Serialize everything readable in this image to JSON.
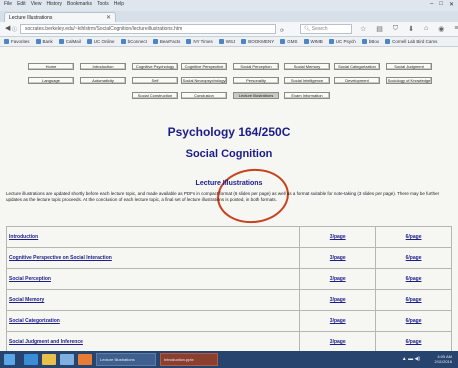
{
  "browser": {
    "menu": [
      "File",
      "Edit",
      "View",
      "History",
      "Bookmarks",
      "Tools",
      "Help"
    ],
    "window_controls": [
      "–",
      "□",
      "✕"
    ],
    "tab_title": "Lecture Illustrations",
    "url": "socrates.berkeley.edu/~kihlstrm/SocialCognition/lectureillustrations.htm",
    "search_placeholder": "Search",
    "bookmarks": [
      "Favorites",
      "Bank",
      "CalMail",
      "UC Online",
      "bConnect",
      "BearFacts",
      "NY Times",
      "WSJ",
      "BOOKMENY",
      "GMS",
      "WIMB",
      "UC Psych",
      "bBox",
      "Cornell Lab Bird Cams"
    ]
  },
  "nav": {
    "row1": [
      "Home",
      "Introduction",
      "Cognitive Psychology",
      "Cognitive Perspective",
      "Social Perception",
      "Social Memory",
      "Social Categorization",
      "Social Judgment"
    ],
    "row2": [
      "Language",
      "Automaticity",
      "Self",
      "Social Neuropsychology",
      "Personality",
      "Social Intelligence",
      "Development",
      "Sociology of Knowledge"
    ],
    "row3": [
      "Social Construction",
      "Conclusion",
      "Lecture Illustrations",
      "Exam Information"
    ],
    "active": "Lecture Illustrations"
  },
  "header": {
    "title": "Psychology 164/250C",
    "subtitle": "Social Cognition",
    "section": "Lecture Illustrations",
    "intro": "Lecture illustrations are updated shortly before each lecture topic, and made available as PDFs in compact format (6 slides per page) as well as a format suitable for note-taking (3 slides per page). There may be further updates as the lecture topic proceeds. At the conclusion of each lecture topic, a final set of lecture illustrations is posted, in both formats."
  },
  "lectures": [
    {
      "topic": "Introduction",
      "three": "3/page",
      "six": "6/page"
    },
    {
      "topic": "Cognitive Perspective on Social Interaction",
      "three": "3/page",
      "six": "6/page"
    },
    {
      "topic": "Social Perception",
      "three": "3/page",
      "six": "6/page"
    },
    {
      "topic": "Social Memory",
      "three": "3/page",
      "six": "6/page"
    },
    {
      "topic": "Social Categorization",
      "three": "3/page",
      "six": "6/page"
    },
    {
      "topic": "Social Judgment and Inference",
      "three": "3/page",
      "six": "6/page"
    }
  ],
  "taskbar": {
    "tasks": [
      "Lecture Illustrations",
      "Introduction.pptx"
    ],
    "time": "4:05 AM",
    "date": "2/11/2016"
  },
  "colors": {
    "heading": "#1c1c8a",
    "highlight_ring": "#c8401e",
    "taskbar": "#27446f"
  }
}
